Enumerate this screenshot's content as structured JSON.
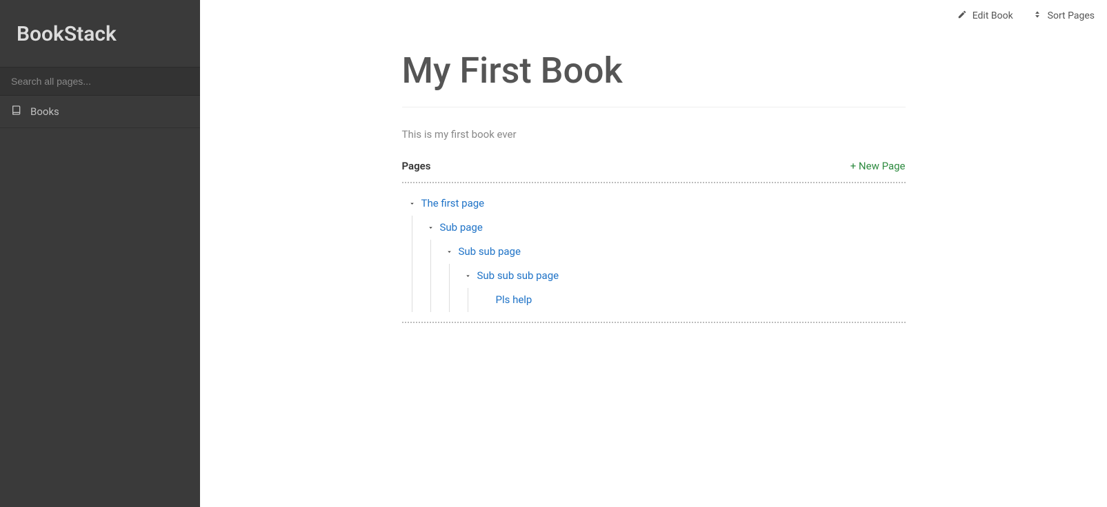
{
  "sidebar": {
    "brand": "BookStack",
    "search_placeholder": "Search all pages...",
    "nav": {
      "books_label": "Books"
    }
  },
  "top_actions": {
    "edit_book": "Edit Book",
    "sort_pages": "Sort Pages"
  },
  "book": {
    "title": "My First Book",
    "description": "This is my first book ever"
  },
  "pages_section": {
    "label": "Pages",
    "new_page": "+ New Page"
  },
  "tree": {
    "l0": {
      "label": "The first page"
    },
    "l1": {
      "label": "Sub page"
    },
    "l2": {
      "label": "Sub sub page"
    },
    "l3": {
      "label": "Sub sub sub page"
    },
    "l4": {
      "label": "Pls help"
    }
  }
}
